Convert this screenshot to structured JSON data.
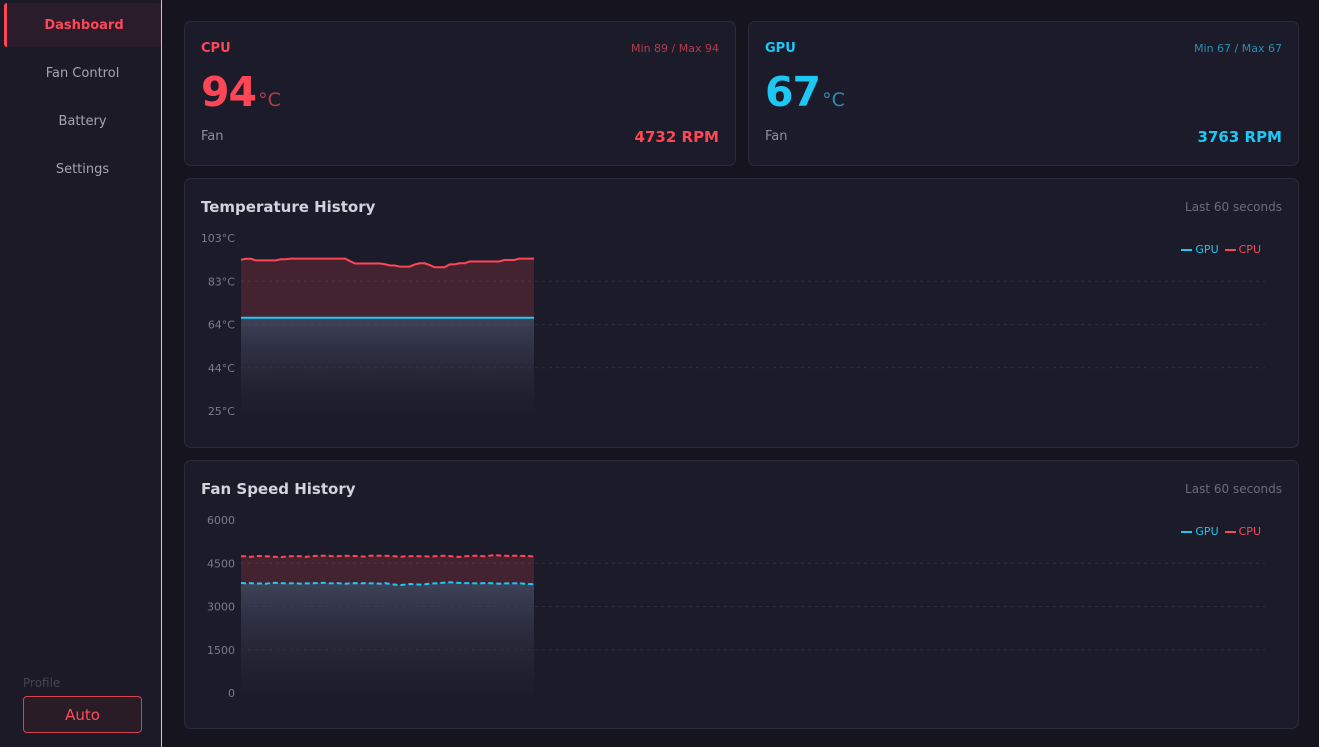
{
  "sidebar": {
    "items": [
      {
        "label": "Dashboard",
        "active": true
      },
      {
        "label": "Fan Control",
        "active": false
      },
      {
        "label": "Battery",
        "active": false
      },
      {
        "label": "Settings",
        "active": false
      }
    ],
    "profile_label": "Profile",
    "profile_value": "Auto"
  },
  "cpu": {
    "label": "CPU",
    "minmax": "Min 89 / Max 94",
    "temp": "94",
    "unit": "°C",
    "fan_label": "Fan",
    "rpm": "4732 RPM"
  },
  "gpu": {
    "label": "GPU",
    "minmax": "Min 67 / Max 67",
    "temp": "67",
    "unit": "°C",
    "fan_label": "Fan",
    "rpm": "3763 RPM"
  },
  "colors": {
    "cpu": "#ff4657",
    "gpu": "#1ec8f5",
    "accent": "#ff4657"
  },
  "temp_chart": {
    "title": "Temperature History",
    "subtitle": "Last 60 seconds",
    "legend": [
      "GPU",
      "CPU"
    ]
  },
  "fan_chart": {
    "title": "Fan Speed History",
    "subtitle": "Last 60 seconds",
    "legend": [
      "GPU",
      "CPU"
    ]
  },
  "chart_data": [
    {
      "type": "area",
      "title": "Temperature History",
      "y_ticks": [
        "103°C",
        "83°C",
        "64°C",
        "44°C",
        "25°C"
      ],
      "ylim": [
        25,
        103
      ],
      "grid": true,
      "legend": "top-right",
      "x_window": 60,
      "series": [
        {
          "name": "GPU",
          "style": "solid",
          "values": [
            67,
            67,
            67,
            67,
            67,
            67,
            67,
            67,
            67,
            67,
            67,
            67,
            67,
            67,
            67,
            67,
            67,
            67,
            67,
            67,
            67,
            67,
            67,
            67,
            67,
            67,
            67,
            67,
            67,
            67,
            67,
            67,
            67,
            67,
            67,
            67,
            67,
            67,
            67,
            67,
            67,
            67,
            67,
            67,
            67,
            67,
            67,
            67,
            67,
            67,
            67,
            67,
            67,
            67,
            67,
            67,
            67,
            67,
            67,
            67
          ]
        },
        {
          "name": "CPU",
          "style": "solid",
          "values": [
            93.2,
            93.6,
            93.6,
            92.9,
            92.9,
            92.9,
            92.9,
            92.9,
            93.4,
            93.4,
            93.7,
            93.7,
            93.7,
            93.7,
            93.7,
            93.7,
            93.7,
            93.7,
            93.7,
            93.7,
            93.7,
            93.7,
            92.5,
            91.5,
            91.5,
            91.5,
            91.5,
            91.5,
            91.5,
            91.2,
            90.6,
            90.6,
            90.1,
            90.1,
            90.1,
            91.1,
            91.6,
            91.6,
            90.8,
            89.8,
            89.8,
            89.8,
            91.1,
            91.1,
            91.6,
            91.6,
            92.4,
            92.4,
            92.4,
            92.4,
            92.4,
            92.4,
            92.4,
            93.1,
            93.1,
            93.1,
            93.7,
            93.7,
            93.7,
            93.7
          ]
        }
      ]
    },
    {
      "type": "area",
      "title": "Fan Speed History",
      "y_ticks": [
        "6000",
        "4500",
        "3000",
        "1500",
        "0"
      ],
      "ylim": [
        0,
        6000
      ],
      "grid": true,
      "legend": "top-right",
      "x_window": 60,
      "series": [
        {
          "name": "GPU",
          "style": "dashed",
          "values": [
            3820,
            3800,
            3810,
            3790,
            3800,
            3790,
            3820,
            3820,
            3810,
            3800,
            3800,
            3810,
            3790,
            3800,
            3800,
            3810,
            3820,
            3820,
            3800,
            3810,
            3800,
            3790,
            3800,
            3810,
            3800,
            3810,
            3800,
            3800,
            3790,
            3810,
            3780,
            3760,
            3740,
            3760,
            3780,
            3770,
            3760,
            3770,
            3790,
            3800,
            3810,
            3830,
            3840,
            3830,
            3820,
            3810,
            3810,
            3800,
            3800,
            3810,
            3810,
            3800,
            3790,
            3800,
            3800,
            3800,
            3810,
            3790,
            3780,
            3770
          ]
        },
        {
          "name": "CPU",
          "style": "dashed",
          "values": [
            4740,
            4740,
            4720,
            4750,
            4750,
            4740,
            4730,
            4720,
            4710,
            4730,
            4740,
            4750,
            4740,
            4720,
            4740,
            4750,
            4760,
            4760,
            4750,
            4740,
            4750,
            4760,
            4750,
            4750,
            4740,
            4730,
            4760,
            4760,
            4760,
            4760,
            4750,
            4740,
            4720,
            4740,
            4740,
            4750,
            4740,
            4740,
            4730,
            4740,
            4750,
            4760,
            4750,
            4730,
            4720,
            4740,
            4750,
            4760,
            4750,
            4740,
            4760,
            4790,
            4770,
            4760,
            4750,
            4760,
            4760,
            4750,
            4750,
            4732
          ]
        }
      ]
    }
  ]
}
